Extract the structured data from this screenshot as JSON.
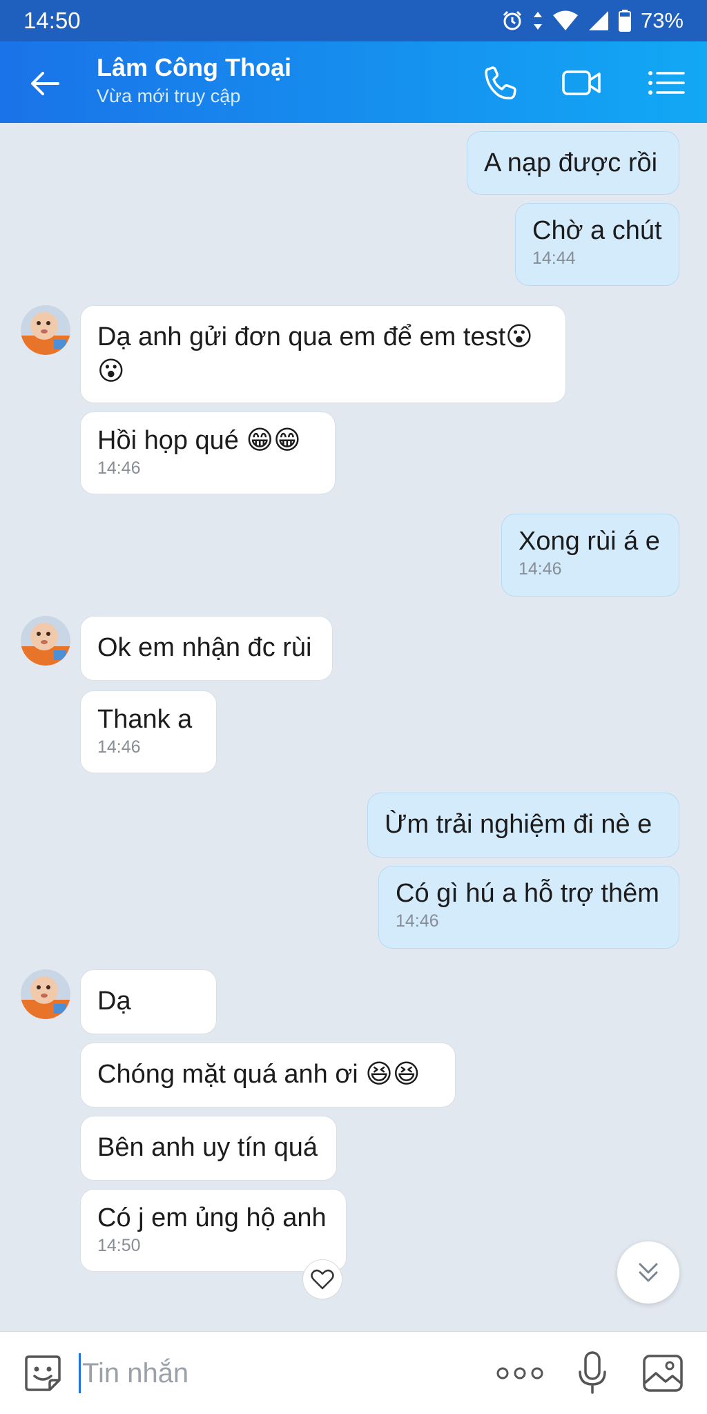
{
  "status_bar": {
    "time": "14:50",
    "battery": "73%"
  },
  "header": {
    "contact_name": "Lâm Công Thoại",
    "contact_status": "Vừa mới truy cập"
  },
  "messages": [
    {
      "dir": "out",
      "text": "A nạp được rồi",
      "time": ""
    },
    {
      "dir": "out",
      "text": "Chờ a chút",
      "time": "14:44"
    },
    {
      "dir": "in",
      "text": "Dạ anh gửi đơn qua em để em test😮",
      "text2": "😮",
      "time": ""
    },
    {
      "dir": "in",
      "text": "Hồi họp qué 😁😁",
      "time": "14:46"
    },
    {
      "dir": "out",
      "text": "Xong rùi á e",
      "time": "14:46"
    },
    {
      "dir": "in",
      "text": "Ok em nhận đc rùi",
      "time": ""
    },
    {
      "dir": "in",
      "text": "Thank a",
      "time": "14:46"
    },
    {
      "dir": "out",
      "text": "Ừm trải nghiệm đi nè e",
      "time": ""
    },
    {
      "dir": "out",
      "text": "Có gì hú a hỗ trợ thêm",
      "time": "14:46"
    },
    {
      "dir": "in",
      "text": "Dạ",
      "time": ""
    },
    {
      "dir": "in",
      "text": "Chóng mặt quá anh ơi 😆😆",
      "time": ""
    },
    {
      "dir": "in",
      "text": "Bên anh uy tín quá",
      "time": ""
    },
    {
      "dir": "in",
      "text": "Có j em ủng hộ anh",
      "time": "14:50"
    }
  ],
  "input": {
    "placeholder": "Tin nhắn"
  },
  "icons": {
    "back": "arrow-left-icon",
    "call": "phone-icon",
    "video": "video-icon",
    "menu": "list-menu-icon",
    "emoji": "sticker-icon",
    "more": "more-dots-icon",
    "mic": "microphone-icon",
    "image": "image-icon",
    "reaction": "heart-icon",
    "scroll": "chevron-double-down-icon"
  },
  "colors": {
    "header_start": "#1a73e8",
    "header_end": "#12a8f5",
    "out_bubble": "#d4ebfc",
    "in_bubble": "#ffffff",
    "chat_bg": "#e2e8f0"
  }
}
